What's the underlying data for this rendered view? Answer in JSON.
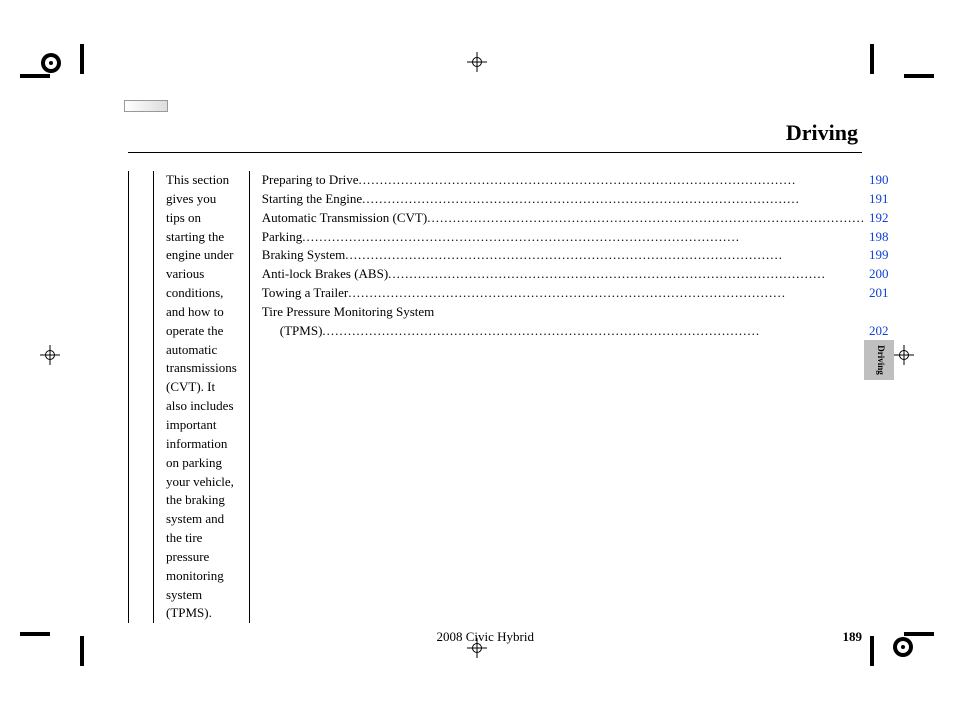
{
  "header": {
    "title": "Driving"
  },
  "intro": "This section gives you tips on starting the engine under various conditions, and how to operate the automatic transmissions (CVT). It also includes important information on parking your vehicle, the braking system and the tire pressure monitoring system (TPMS).",
  "toc": [
    {
      "label": "Preparing to Drive",
      "page": "190"
    },
    {
      "label": "Starting the Engine",
      "page": "191"
    },
    {
      "label": "Automatic Transmission (CVT)",
      "page": "192"
    },
    {
      "label": "Parking",
      "page": "198"
    },
    {
      "label": "Braking System",
      "page": "199"
    },
    {
      "label": "Anti-lock Brakes (ABS)",
      "page": "200"
    },
    {
      "label": "Towing a Trailer",
      "page": "201"
    },
    {
      "label": "Tire Pressure Monitoring System",
      "cont": "(TPMS)",
      "page": "202"
    }
  ],
  "side_tab": "Driving",
  "footer": {
    "model": "2008  Civic  Hybrid",
    "page_number": "189"
  }
}
